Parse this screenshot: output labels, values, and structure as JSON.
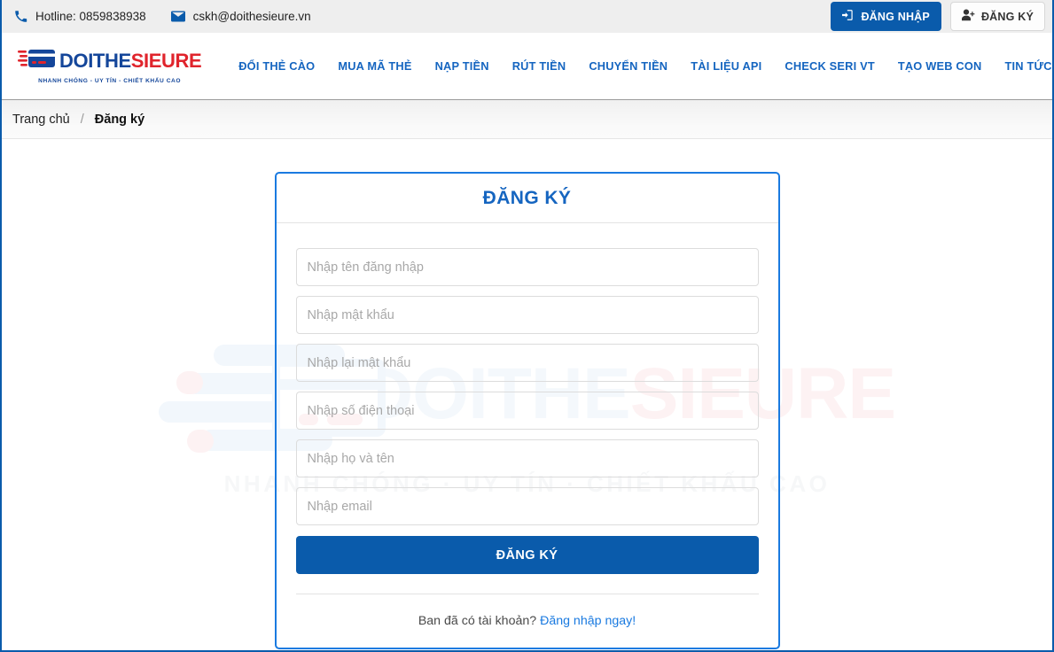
{
  "topbar": {
    "phone_icon": "phone-icon",
    "phone": "Hotline: 0859838938",
    "mail_icon": "mail-icon",
    "email": "cskh@doithesieure.vn",
    "login_label": "ĐĂNG NHẬP",
    "login_icon": "sign-in-icon",
    "register_label": "ĐĂNG KÝ",
    "register_icon": "user-plus-icon",
    "login_bg": "#0a5bab"
  },
  "brand": {
    "name_part1": "DOITHE",
    "name_part2": "SIEURE",
    "tagline": "NHANH CHÓNG - UY TÍN - CHIẾT KHẤU CAO",
    "color_blue": "#14469a",
    "color_red": "#e0242c",
    "logo_icon": "card-swipe-logo-icon"
  },
  "nav": {
    "items": [
      {
        "label": "ĐỔI THẺ CÀO"
      },
      {
        "label": "MUA MÃ THẺ"
      },
      {
        "label": "NẠP TIỀN"
      },
      {
        "label": "RÚT TIỀN"
      },
      {
        "label": "CHUYỂN TIỀN"
      },
      {
        "label": "TÀI LIỆU API"
      },
      {
        "label": "CHECK SERI VT"
      },
      {
        "label": "TẠO WEB CON"
      },
      {
        "label": "TIN TỨC"
      }
    ]
  },
  "breadcrumb": {
    "home": "Trang chủ",
    "separator": "/",
    "current": "Đăng ký"
  },
  "watermark": {
    "word1": "DOITHE",
    "word2": "SIEURE",
    "tagline": "NHANH CHÓNG · UY TÍN · CHIẾT KHẤU CAO"
  },
  "form": {
    "title": "ĐĂNG KÝ",
    "fields": [
      {
        "name": "username",
        "placeholder": "Nhập tên đăng nhập",
        "value": "",
        "type": "text"
      },
      {
        "name": "password",
        "placeholder": "Nhập mật khẩu",
        "value": "",
        "type": "text"
      },
      {
        "name": "password-confirm",
        "placeholder": "Nhập lại mật khẩu",
        "value": "",
        "type": "text"
      },
      {
        "name": "phone",
        "placeholder": "Nhập số điện thoại",
        "value": "",
        "type": "text"
      },
      {
        "name": "fullname",
        "placeholder": "Nhập họ và tên",
        "value": "",
        "type": "text"
      },
      {
        "name": "email",
        "placeholder": "Nhập email",
        "value": "",
        "type": "text"
      }
    ],
    "submit_label": "ĐĂNG KÝ",
    "footer_text": "Ban đã có tài khoản? ",
    "footer_link": "Đăng nhập ngay!",
    "accent": "#1a7ae0",
    "submit_bg": "#0a5bab"
  }
}
